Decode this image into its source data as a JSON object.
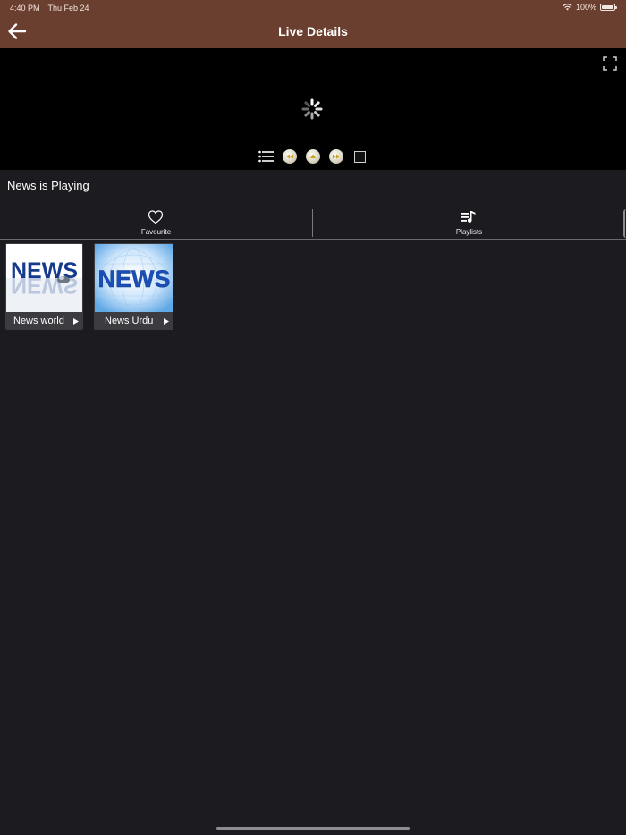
{
  "status_bar": {
    "time": "4:40 PM",
    "date": "Thu Feb 24",
    "battery": "100%"
  },
  "header": {
    "title": "Live Details",
    "back_icon": "arrow-left-icon",
    "background": "#6b3f2f"
  },
  "player": {
    "background": "#000000",
    "fullscreen_icon": "fullscreen-icon",
    "loading_icon": "spinner-icon",
    "controls": [
      "list-icon",
      "rewind-icon",
      "play-icon",
      "forward-icon",
      "epg-icon"
    ]
  },
  "now_playing": "News is Playing",
  "tabs": [
    {
      "label": "Favourite",
      "icon": "heart-icon"
    },
    {
      "label": "Playlists",
      "icon": "playlist-icon"
    }
  ],
  "channels": [
    {
      "name": "News world",
      "thumb_text": "NEWS"
    },
    {
      "name": "News Urdu",
      "thumb_text": "NEWS"
    }
  ]
}
